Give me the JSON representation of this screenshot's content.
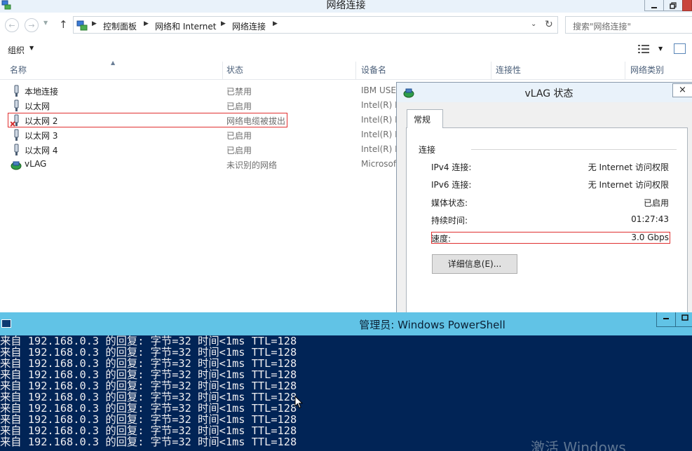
{
  "explorer": {
    "title": "网络连接",
    "breadcrumb": [
      "控制面板",
      "网络和 Internet",
      "网络连接"
    ],
    "search_placeholder": "搜索\"网络连接\"",
    "organize_label": "组织",
    "columns": [
      "名称",
      "状态",
      "设备名",
      "连接性",
      "网络类别"
    ],
    "rows": [
      {
        "name": "本地连接",
        "status": "已禁用",
        "device": "IBM USE"
      },
      {
        "name": "以太网",
        "status": "已启用",
        "device": "Intel(R) I"
      },
      {
        "name": "以太网 2",
        "status": "网络电缆被拔出",
        "device": "Intel(R) I"
      },
      {
        "name": "以太网 3",
        "status": "已启用",
        "device": "Intel(R) I"
      },
      {
        "name": "以太网 4",
        "status": "已启用",
        "device": "Intel(R) I"
      },
      {
        "name": "vLAG",
        "status": "未识别的网络",
        "device": "Microsof"
      }
    ]
  },
  "dialog": {
    "title": "vLAG 状态",
    "tab": "常规",
    "group_label": "连接",
    "fields": [
      {
        "key": "IPv4 连接:",
        "value": "无 Internet 访问权限"
      },
      {
        "key": "IPv6 连接:",
        "value": "无 Internet 访问权限"
      },
      {
        "key": "媒体状态:",
        "value": "已启用"
      },
      {
        "key": "持续时间:",
        "value": "01:27:43"
      },
      {
        "key": "速度:",
        "value": "3.0 Gbps"
      }
    ],
    "details_button": "详细信息(E)...",
    "close_label": "×"
  },
  "powershell": {
    "title": "管理员: Windows PowerShell",
    "lines": [
      "来自 192.168.0.3 的回复: 字节=32 时间<1ms TTL=128",
      "来自 192.168.0.3 的回复: 字节=32 时间<1ms TTL=128",
      "来自 192.168.0.3 的回复: 字节=32 时间<1ms TTL=128",
      "来自 192.168.0.3 的回复: 字节=32 时间<1ms TTL=128",
      "来自 192.168.0.3 的回复: 字节=32 时间<1ms TTL=128",
      "来自 192.168.0.3 的回复: 字节=32 时间<1ms TTL=128",
      "来自 192.168.0.3 的回复: 字节=32 时间<1ms TTL=128",
      "来自 192.168.0.3 的回复: 字节=32 时间<1ms TTL=128",
      "来自 192.168.0.3 的回复: 字节=32 时间<1ms TTL=128",
      "来自 192.168.0.3 的回复: 字节=32 时间<1ms TTL=128"
    ],
    "watermark": "激活 Windows"
  },
  "colors": {
    "explorer_titlebar": "#e9f2fa",
    "highlight_box": "#e03030",
    "ps_titlebar": "#61c3e6",
    "ps_background": "#012456",
    "ps_text": "#eeedf0"
  },
  "icons": {
    "app": "network-connections-icon",
    "adapter": "network-adapter-icon",
    "adapter_error": "network-adapter-unplugged-icon",
    "vlag": "team-adapter-icon",
    "powershell": "powershell-icon"
  }
}
